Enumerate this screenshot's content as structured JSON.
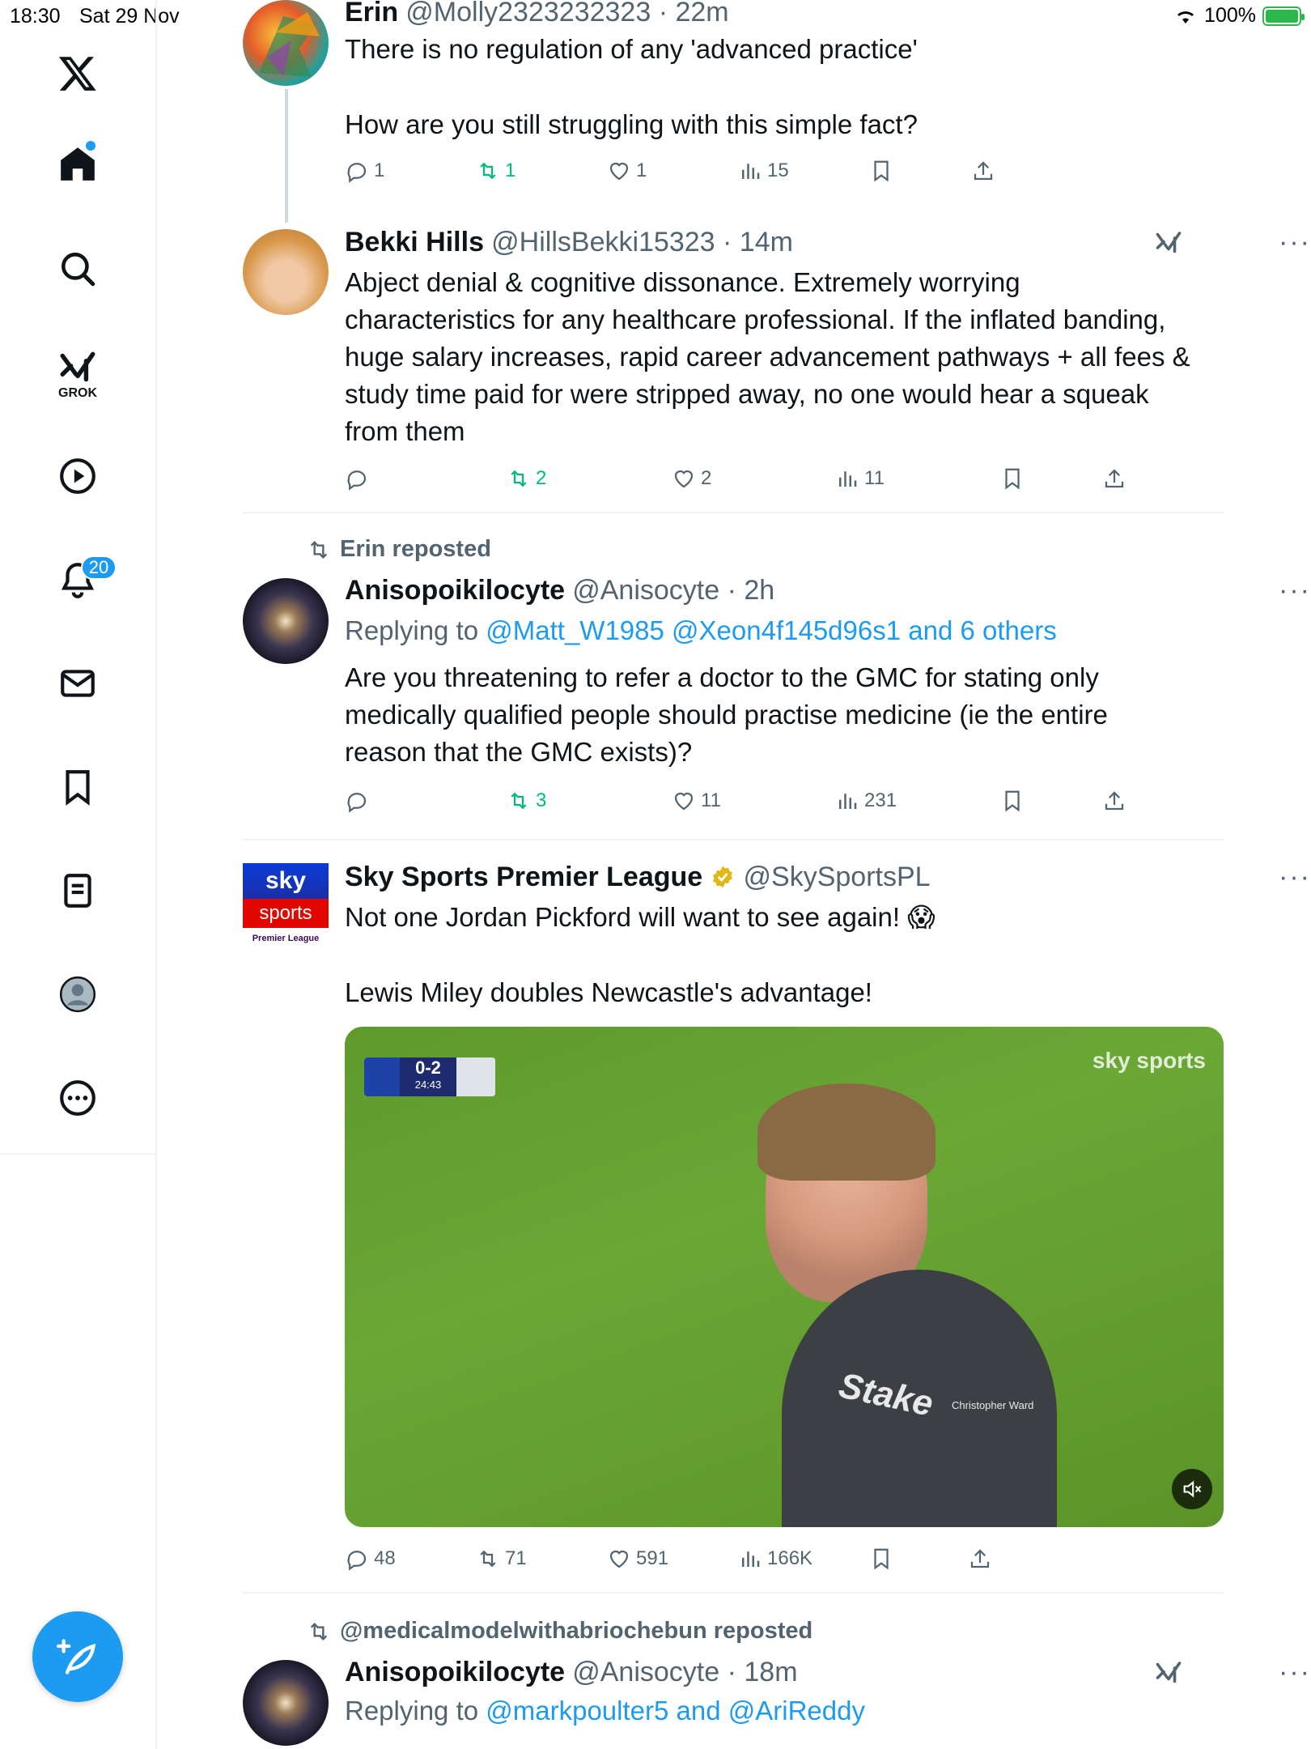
{
  "status_bar": {
    "time": "18:30",
    "date": "Sat 29 Nov",
    "battery": "100%"
  },
  "sidebar": {
    "grok_label": "GROK",
    "notifications_count": "20",
    "items": [
      "home-icon",
      "search-icon",
      "grok-icon",
      "video-icon",
      "notifications-icon",
      "messages-icon",
      "bookmarks-icon",
      "lists-icon",
      "profile-icon",
      "more-icon"
    ]
  },
  "tweets": [
    {
      "name": "Erin",
      "handle": "@Molly2323232323 · 22m",
      "lines": [
        "There is no regulation of any 'advanced practice'",
        "How are you still struggling with this simple fact?"
      ],
      "replies": "1",
      "reposts": "1",
      "likes": "1",
      "views": "15"
    },
    {
      "name": "Bekki Hills",
      "handle": "@HillsBekki15323 · 14m",
      "lines": [
        "Abject denial & cognitive dissonance. Extremely worrying",
        "characteristics for any healthcare professional. If the inflated banding,",
        "huge salary increases, rapid career advancement pathways + all fees &",
        "study time paid for were stripped away, no one would hear a squeak",
        "from them"
      ],
      "replies": "",
      "reposts": "2",
      "likes": "2",
      "views": "11"
    },
    {
      "repost_label": "Erin reposted",
      "name": "Anisopoikilocyte",
      "handle": "@Anisocyte · 2h",
      "replying_prefix": "Replying to ",
      "replying_to": "@Matt_W1985 @Xeon4f145d96s1 and 6 others",
      "lines": [
        "Are you threatening to refer a doctor to the GMC for stating only",
        "medically qualified people should practise medicine (ie the entire",
        "reason that the GMC exists)?"
      ],
      "replies": "",
      "reposts": "3",
      "likes": "11",
      "views": "231"
    },
    {
      "name": "Sky Sports Premier League",
      "handle": "@SkySportsPL",
      "avatar_text_top": "sky",
      "avatar_text_mid": "sports",
      "avatar_text_bot": "Premier League",
      "lines": [
        "Not one Jordan Pickford will want to see again! 😱",
        "Lewis Miley doubles Newcastle's advantage!"
      ],
      "media": {
        "score": "0-2",
        "clock": "24:43",
        "watermark": "sky sports",
        "shirt_sponsor": "Stake",
        "shirt_partner": "Christopher Ward"
      },
      "replies": "48",
      "reposts": "71",
      "likes": "591",
      "views": "166K"
    },
    {
      "repost_label": "@medicalmodelwithabriochebun reposted",
      "name": "Anisopoikilocyte",
      "handle": "@Anisocyte · 18m",
      "replying_prefix": "Replying to ",
      "replying_to": "@markpoulter5 and @AriReddy"
    }
  ],
  "colors": {
    "accent": "#1d9bf0",
    "repost_green": "#00ba7c",
    "muted": "#536471",
    "sky_red": "#e10600",
    "sky_blue": "#0033cc"
  }
}
